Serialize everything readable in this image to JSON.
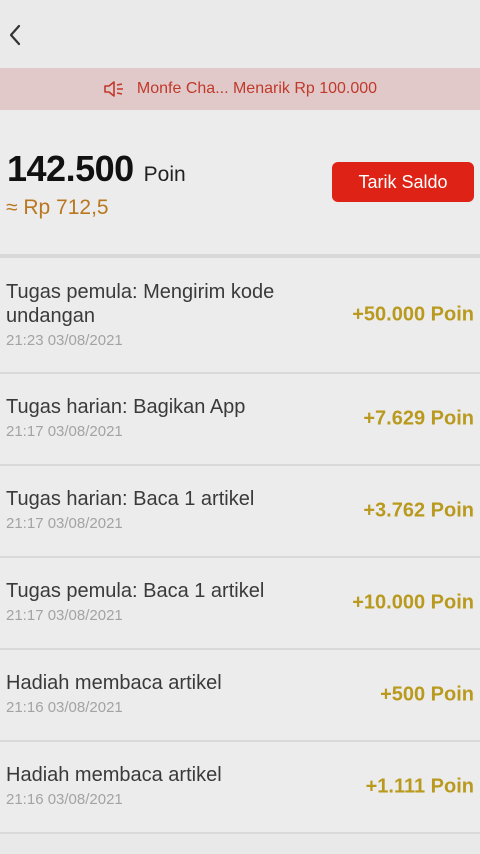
{
  "notice": {
    "text": "Monfe Cha... Menarik Rp 100.000"
  },
  "balance": {
    "points": "142.500",
    "points_unit": "Poin",
    "rupiah": "≈ Rp 712,5",
    "withdraw_label": "Tarik Saldo"
  },
  "transactions": [
    {
      "title": "Tugas pemula: Mengirim kode undangan",
      "time": "21:23 03/08/2021",
      "amount": "+50.000 Poin"
    },
    {
      "title": "Tugas harian: Bagikan App",
      "time": "21:17 03/08/2021",
      "amount": "+7.629 Poin"
    },
    {
      "title": "Tugas harian: Baca 1 artikel",
      "time": "21:17 03/08/2021",
      "amount": "+3.762 Poin"
    },
    {
      "title": "Tugas pemula: Baca 1 artikel",
      "time": "21:17 03/08/2021",
      "amount": "+10.000 Poin"
    },
    {
      "title": "Hadiah membaca artikel",
      "time": "21:16 03/08/2021",
      "amount": "+500 Poin"
    },
    {
      "title": "Hadiah membaca artikel",
      "time": "21:16 03/08/2021",
      "amount": "+1.111 Poin"
    }
  ],
  "colors": {
    "accent": "#df2216",
    "amount": "#b99a1e",
    "rupiah": "#b9771f"
  },
  "icons": {
    "back": "chevron-left-icon",
    "notice": "speaker-icon"
  }
}
